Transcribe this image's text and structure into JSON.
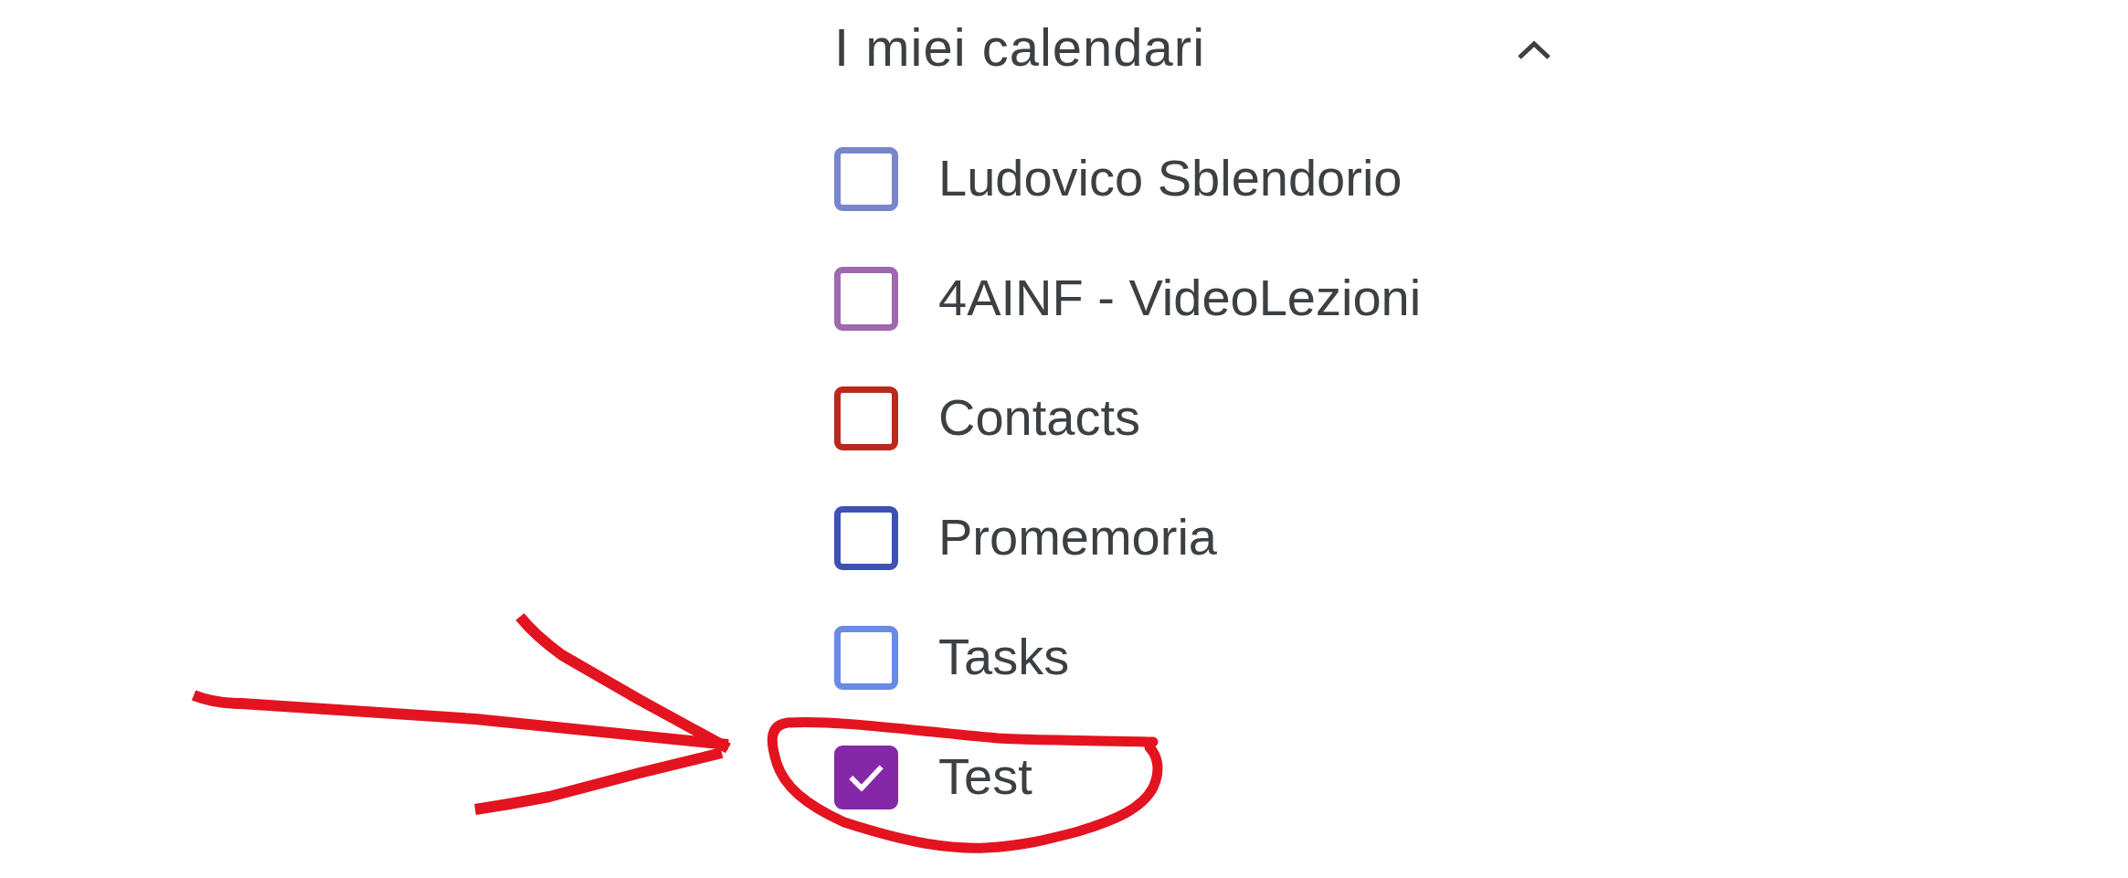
{
  "section": {
    "title": "I miei calendari",
    "expanded": true
  },
  "calendars": [
    {
      "name": "Ludovico Sblendorio",
      "color": "#7986cb",
      "checked": false
    },
    {
      "name": "4AINF - VideoLezioni",
      "color": "#9e69af",
      "checked": false
    },
    {
      "name": "Contacts",
      "color": "#b9291c",
      "checked": false
    },
    {
      "name": "Promemoria",
      "color": "#3f51b5",
      "checked": false
    },
    {
      "name": "Tasks",
      "color": "#6a8ae8",
      "checked": false
    },
    {
      "name": "Test",
      "color": "#8428a8",
      "checked": true
    }
  ]
}
